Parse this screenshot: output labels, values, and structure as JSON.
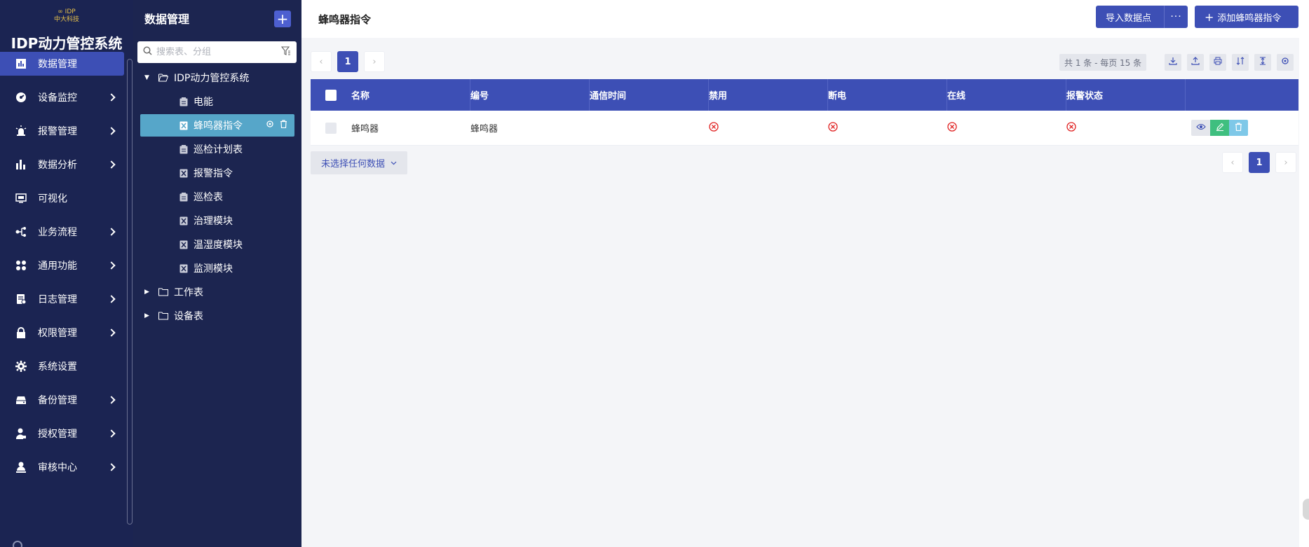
{
  "app": {
    "logo_text": "IDP",
    "logo_sub": "中大科技",
    "system_name": "IDP动力管控系统"
  },
  "nav": {
    "items": [
      {
        "label": "数据管理",
        "icon": "bar-chart-icon",
        "active": true
      },
      {
        "label": "设备监控",
        "icon": "dashboard-icon",
        "has_children": true
      },
      {
        "label": "报警管理",
        "icon": "alarm-icon",
        "has_children": true
      },
      {
        "label": "数据分析",
        "icon": "analytics-icon",
        "has_children": true
      },
      {
        "label": "可视化",
        "icon": "monitor-icon"
      },
      {
        "label": "业务流程",
        "icon": "flow-icon",
        "has_children": true
      },
      {
        "label": "通用功能",
        "icon": "grid-icon",
        "has_children": true
      },
      {
        "label": "日志管理",
        "icon": "log-icon",
        "has_children": true
      },
      {
        "label": "权限管理",
        "icon": "lock-icon",
        "has_children": true
      },
      {
        "label": "系统设置",
        "icon": "gear-icon"
      },
      {
        "label": "备份管理",
        "icon": "backup-icon",
        "has_children": true
      },
      {
        "label": "授权管理",
        "icon": "user-key-icon",
        "has_children": true
      },
      {
        "label": "审核中心",
        "icon": "user-icon",
        "has_children": true
      }
    ]
  },
  "tree": {
    "title": "数据管理",
    "search_placeholder": "搜索表、分组",
    "root": "IDP动力管控系统",
    "children": [
      "电能",
      "蜂鸣器指令",
      "巡检计划表",
      "报警指令",
      "巡检表",
      "治理模块",
      "温湿度模块",
      "监测模块"
    ],
    "selected": "蜂鸣器指令",
    "other_groups": [
      "工作表",
      "设备表"
    ]
  },
  "main": {
    "title": "蜂鸣器指令",
    "import_label": "导入数据点",
    "more_label": "···",
    "add_label": "添加蜂鸣器指令",
    "summary": "共 1 条 - 每页 15 条",
    "current_page": "1",
    "columns": [
      "名称",
      "编号",
      "通信时间",
      "禁用",
      "断电",
      "在线",
      "报警状态"
    ],
    "rows": [
      {
        "name": "蜂鸣器",
        "code": "蜂鸣器",
        "time": "",
        "disabled": false,
        "power_off": false,
        "online": false,
        "alarm": false
      }
    ],
    "selection_label": "未选择任何数据"
  },
  "colors": {
    "primary": "#3d4fb5",
    "sidebar": "#1b2452",
    "tree_selected": "#56a6c9",
    "status_false": "#e02020",
    "edit": "#3fbf7f",
    "delete": "#7ec8e8"
  }
}
